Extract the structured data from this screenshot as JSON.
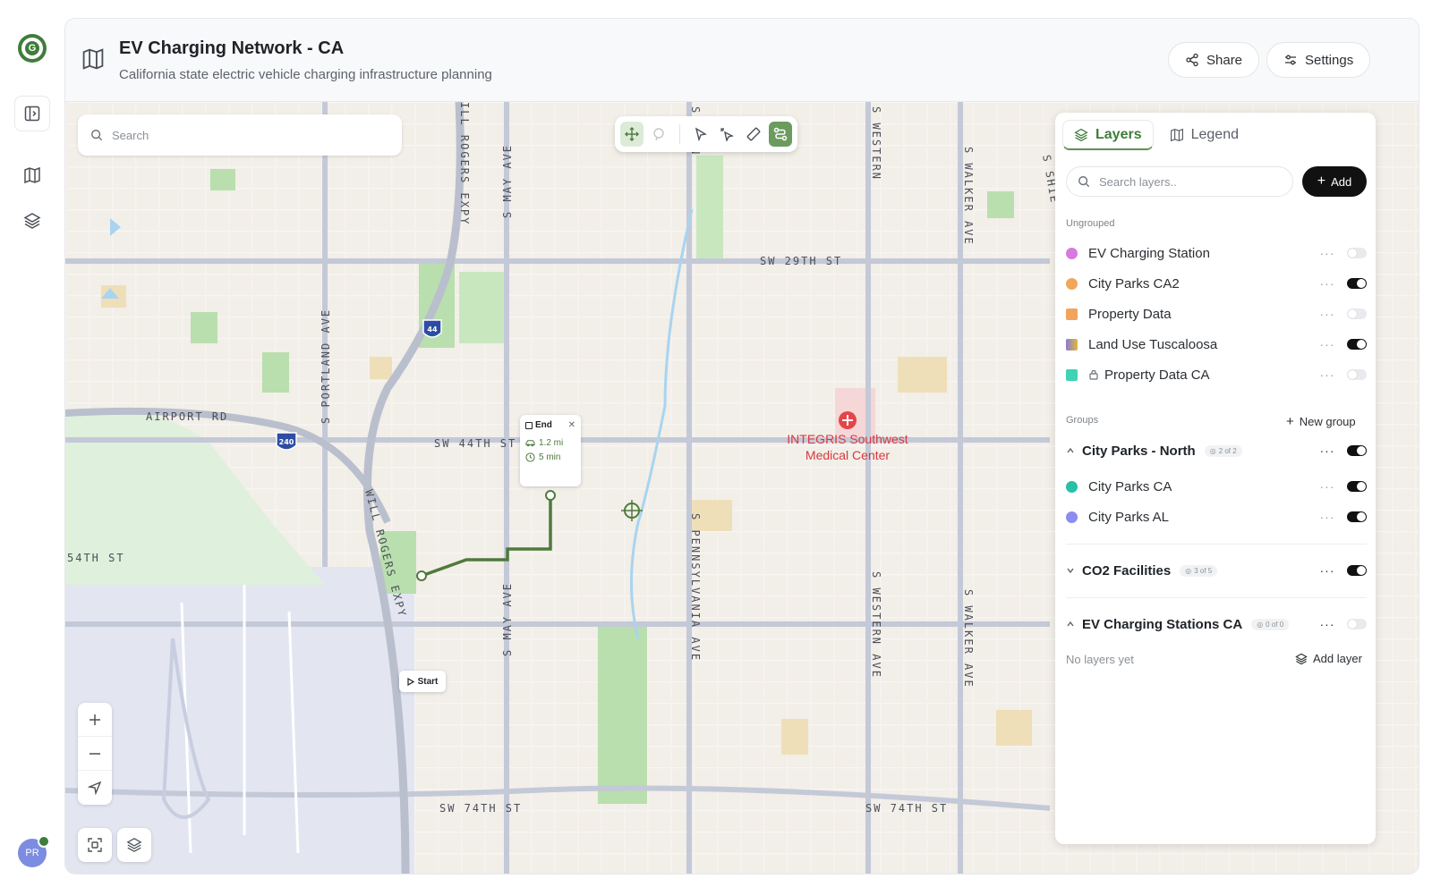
{
  "header": {
    "title": "EV Charging Network - CA",
    "subtitle": "California state electric vehicle charging infrastructure planning",
    "share_label": "Share",
    "settings_label": "Settings"
  },
  "rail": {
    "avatar_initials": "PR"
  },
  "map": {
    "search_placeholder": "Search",
    "streets": [
      "SW 29TH ST",
      "SW 44TH ST",
      "SW 74TH ST",
      "SW 74TH ST",
      "AIRPORT RD",
      "54TH ST",
      "S MAY AVE",
      "S MAY AVE",
      "S PORTLAND AVE",
      "WILL ROGERS EXPY",
      "S PENNSYLVANIA AVE",
      "S WESTERN AVE",
      "S WALKER AVE",
      "S PENN",
      "S WESTERN",
      "S WALKER AVE",
      "S SHIE",
      "ILL ROGERS EXPY"
    ],
    "shields": [
      "44",
      "240"
    ],
    "poi": "INTEGRIS Southwest Medical Center",
    "route": {
      "end_label": "End",
      "distance": "1.2 mi",
      "duration": "5 min",
      "start_label": "Start"
    }
  },
  "panel": {
    "tabs": [
      {
        "label": "Layers"
      },
      {
        "label": "Legend"
      }
    ],
    "search_placeholder": "Search layers..",
    "add_label": "Add",
    "ungrouped_label": "Ungrouped",
    "ungrouped": [
      {
        "name": "EV Charging Station",
        "color": "#d77ae0",
        "on": false
      },
      {
        "name": "City Parks CA2",
        "color": "#f0a75a",
        "on": true
      },
      {
        "name": "Property Data",
        "color": "#f2a35d",
        "on": false
      },
      {
        "name": "Land Use Tuscaloosa",
        "color": "#e2b83c",
        "on": true
      },
      {
        "name": "Property Data CA",
        "color": "#3fd3b4",
        "on": false
      }
    ],
    "groups_label": "Groups",
    "new_group_label": "New group",
    "groups": [
      {
        "name": "City Parks - North",
        "count": "2 of 2",
        "on": true,
        "layers": [
          {
            "name": "City Parks CA",
            "color": "#27c0a8",
            "on": true
          },
          {
            "name": "City Parks AL",
            "color": "#8c8cf0",
            "on": true
          }
        ]
      },
      {
        "name": "CO2 Facilities",
        "count": "3 of 5",
        "on": true
      },
      {
        "name": "EV Charging Stations CA",
        "count": "0 of 0",
        "on": false
      }
    ],
    "no_layers_label": "No layers yet",
    "add_layer_label": "Add layer"
  }
}
